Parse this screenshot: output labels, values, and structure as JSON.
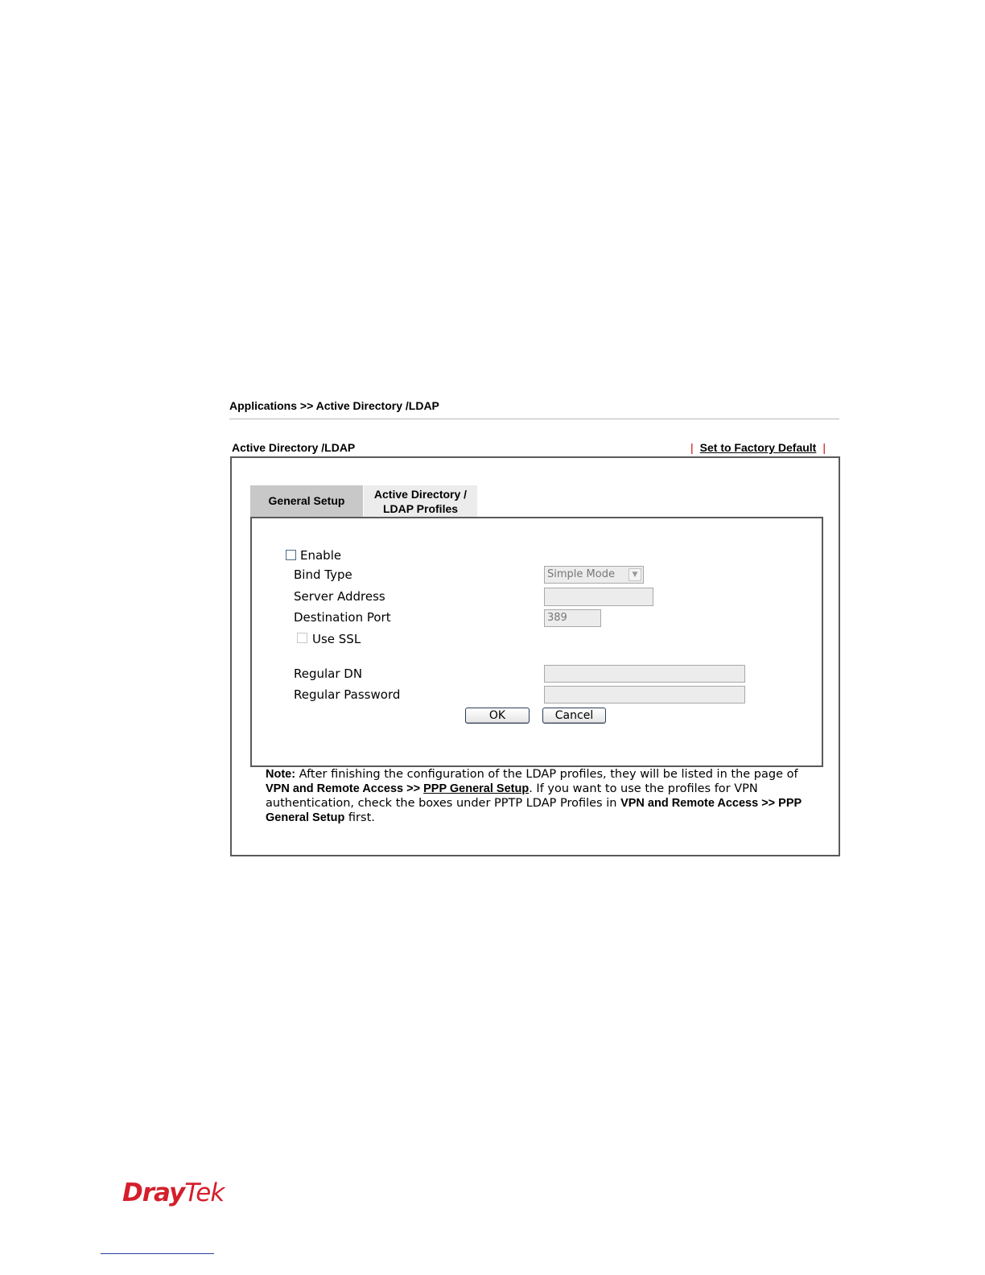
{
  "breadcrumb": "Applications >> Active Directory /LDAP",
  "section": {
    "title": "Active Directory /LDAP",
    "factory_default_link": "Set to Factory Default"
  },
  "tabs": [
    {
      "line1": "General Setup",
      "line2": ""
    },
    {
      "line1": "Active Directory /",
      "line2": "LDAP Profiles"
    }
  ],
  "form": {
    "enable_label": "Enable",
    "enable_checked": false,
    "bind_type_label": "Bind Type",
    "bind_type_value": "Simple Mode",
    "server_address_label": "Server Address",
    "server_address_value": "",
    "destination_port_label": "Destination Port",
    "destination_port_value": "389",
    "use_ssl_label": "Use SSL",
    "use_ssl_checked": false,
    "regular_dn_label": "Regular DN",
    "regular_dn_value": "",
    "regular_password_label": "Regular Password",
    "regular_password_value": ""
  },
  "buttons": {
    "ok": "OK",
    "cancel": "Cancel"
  },
  "note": {
    "prefix": "Note:",
    "text1": " After finishing the configuration of the LDAP profiles, they will be listed in the page of ",
    "bold1": "VPN and Remote Access >> ",
    "link1": "PPP General Setup",
    "text2": ". If you want to use the profiles for VPN authentication, check the boxes under PPTP LDAP Profiles in ",
    "bold2": "VPN and Remote Access >> PPP General Setup",
    "text3": " first."
  },
  "logo": {
    "part1": "Dray",
    "part2": "Tek",
    "color": "#d41f2b"
  },
  "colors": {
    "border": "#5a5a5a",
    "tab_active": "#c8c8c8",
    "tab_inactive": "#ececec",
    "field_disabled": "#ececec",
    "separator_red": "#cc0000"
  }
}
